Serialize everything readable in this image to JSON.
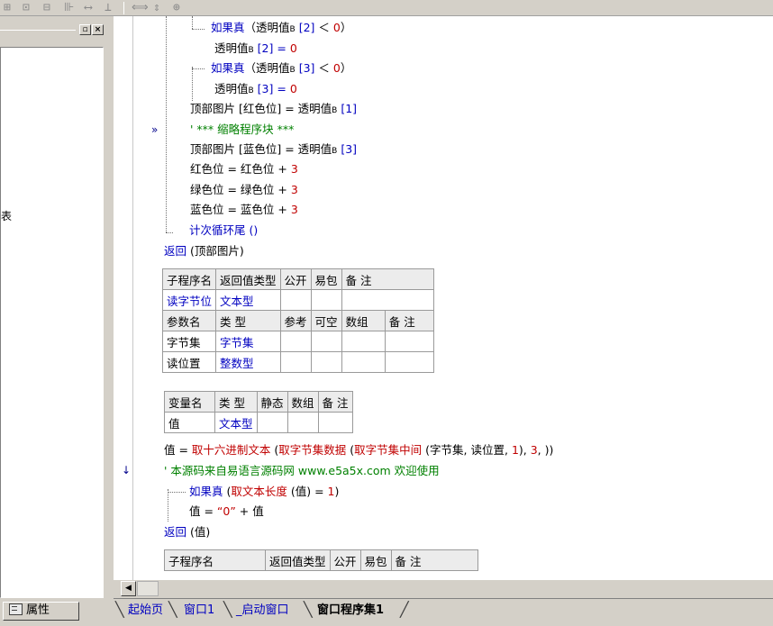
{
  "toolbar": {
    "icons": [
      "align-left-icon",
      "align-center-icon",
      "align-right-icon",
      "distribute-icon",
      "same-width-icon",
      "same-height-icon",
      "same-size-icon"
    ]
  },
  "left_panel": {
    "close_glyph": "×",
    "restore_glyph": "▫",
    "clipped_text": "表"
  },
  "properties_tab": {
    "label": "属性"
  },
  "code": {
    "if1": {
      "kw": "如果真",
      "open": "（透明值",
      "b": "B",
      "idx": " [2] ",
      "lt": "＜ ",
      "num": "0",
      "close": "）"
    },
    "assign1": {
      "lhs": "透明值",
      "b": "B",
      "idx": " [2] = ",
      "num": "0"
    },
    "if2": {
      "kw": "如果真",
      "open": "（透明值",
      "b": "B",
      "idx": " [3] ",
      "lt": "＜ ",
      "num": "0",
      "close": "）"
    },
    "assign2": {
      "lhs": "透明值",
      "b": "B",
      "idx": " [3] = ",
      "num": "0"
    },
    "top_red": {
      "text": "顶部图片 [红色位] = 透明值",
      "b": "B",
      "idx": " [1]"
    },
    "comment1": {
      "text": "' *** 缩略程序块 ***"
    },
    "top_blue": {
      "text": "顶部图片 [蓝色位] = 透明值",
      "b": "B",
      "idx": " [3]"
    },
    "red_inc": {
      "text": "红色位 = 红色位 + ",
      "num": "3"
    },
    "green_inc": {
      "text": "绿色位 = 绿色位 + ",
      "num": "3"
    },
    "blue_inc": {
      "text": "蓝色位 = 蓝色位 + ",
      "num": "3"
    },
    "loop_end": {
      "text": "计次循环尾 ()"
    },
    "return1": {
      "kw": "返回",
      "rest": " (顶部图片)"
    },
    "value_assign": {
      "lhs": "值 = ",
      "f1": "取十六进制文本",
      "p1": " (",
      "f2": "取字节集数据",
      "p2": " (",
      "f3": "取字节集中间",
      "args": " (字节集, 读位置, ",
      "n1": "1",
      "c1": "), ",
      "n2": "3",
      "tail": ", ))"
    },
    "comment2": {
      "text": "' 本源码来自易语言源码网 www.e5a5x.com  欢迎使用"
    },
    "if3": {
      "kw": "如果真",
      "open": " (",
      "fn": "取文本长度",
      "rest": " (值) = ",
      "num": "1",
      "close": ")"
    },
    "value_concat": {
      "lhs": "值 = ",
      "str": "“0”",
      "rest": " + 值"
    },
    "return2": {
      "kw": "返回",
      "rest": " (值)"
    }
  },
  "sub_table": {
    "header": [
      "子程序名",
      "返回值类型",
      "公开",
      "易包",
      "备 注"
    ],
    "row": [
      "读字节位",
      "文本型",
      "",
      "",
      ""
    ],
    "param_header": [
      "参数名",
      "类 型",
      "参考",
      "可空",
      "数组",
      "备 注"
    ],
    "params": [
      [
        "字节集",
        "字节集",
        "",
        "",
        "",
        ""
      ],
      [
        "读位置",
        "整数型",
        "",
        "",
        "",
        ""
      ]
    ]
  },
  "var_table": {
    "header": [
      "变量名",
      "类 型",
      "静态",
      "数组",
      "备 注"
    ],
    "row": [
      "值",
      "文本型",
      "",
      "",
      ""
    ]
  },
  "sub_table2": {
    "header": [
      "子程序名",
      "返回值类型",
      "公开",
      "易包",
      "备 注"
    ]
  },
  "tabs": [
    {
      "label": "起始页",
      "active": false
    },
    {
      "label": "窗口1",
      "active": false
    },
    {
      "label": "_启动窗口",
      "active": false
    },
    {
      "label": "窗口程序集1",
      "active": true
    }
  ],
  "colors": {
    "keyword": "#0000c0",
    "number": "#c00000",
    "comment": "#008000",
    "background": "#d4d0c8"
  }
}
